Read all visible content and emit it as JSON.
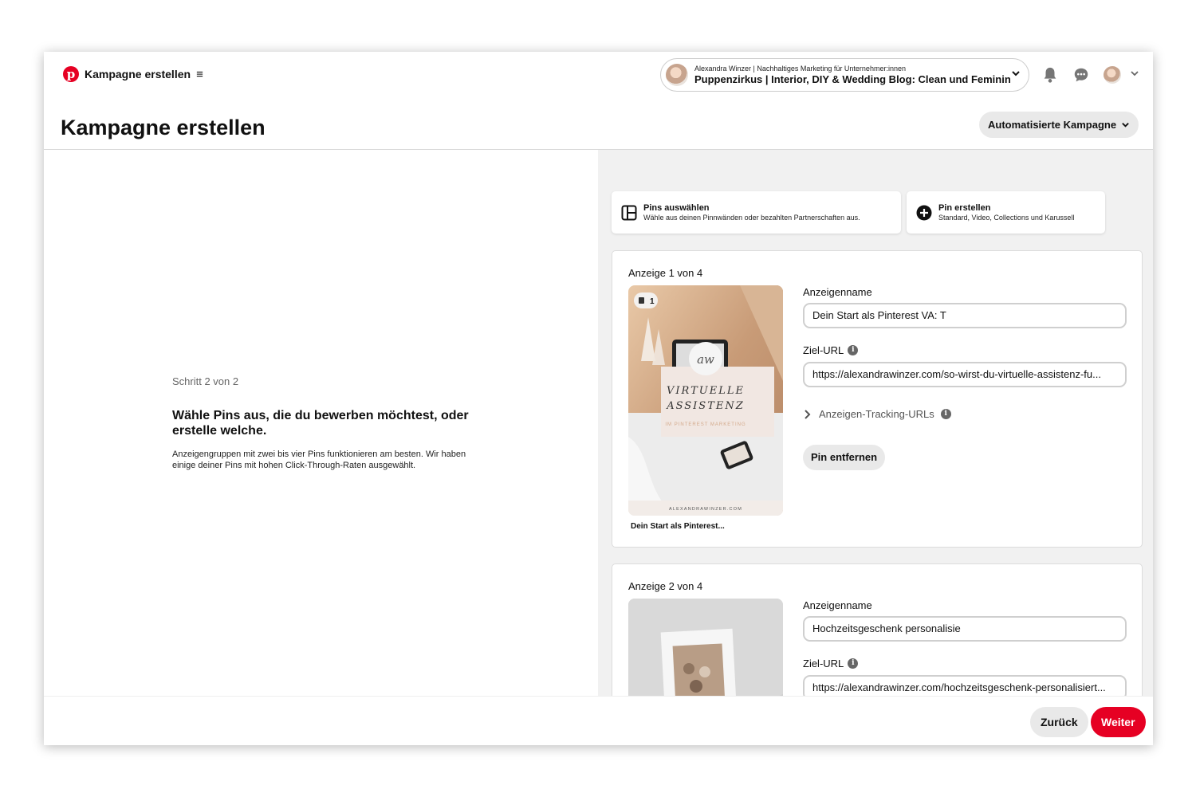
{
  "topbar": {
    "brand_label": "Kampagne erstellen",
    "menu_icon": "hamburger-icon",
    "account": {
      "subtitle": "Alexandra Winzer | Nachhaltiges Marketing für Unternehmer:innen",
      "name": "Puppenzirkus | Interior, DIY & Wedding Blog: Clean und Feminin"
    },
    "icons": [
      "pinterest-logo-icon",
      "bell-icon",
      "chat-icon",
      "chevron-down-icon"
    ]
  },
  "header": {
    "title": "Kampagne erstellen",
    "campaign_type": "Automatisierte Kampagne"
  },
  "left": {
    "step": "Schritt 2 von 2",
    "heading": "Wähle Pins aus, die du bewerben möchtest, oder erstelle welche.",
    "description": "Anzeigengruppen mit zwei bis vier Pins funktionieren am besten. Wir haben einige deiner Pins mit hohen Click-Through-Raten ausgewählt."
  },
  "options": {
    "select": {
      "title": "Pins auswählen",
      "subtitle": "Wähle aus deinen Pinnwänden oder bezahlten Partnerschaften aus."
    },
    "create": {
      "title": "Pin erstellen",
      "subtitle": "Standard, Video, Collections und Karussell"
    }
  },
  "ads": [
    {
      "label": "Anzeige 1 von 4",
      "count_badge": "1",
      "pin_title_line1": "VIRTUELLE",
      "pin_title_line2": "ASSISTENZ",
      "pin_subtitle": "IM PINTEREST MARKETING",
      "pin_monogram": "aw",
      "pin_footer": "ALEXANDRAWINZER.COM",
      "caption": "Dein Start als Pinterest...",
      "name_label": "Anzeigenname",
      "name_value": "Dein Start als Pinterest VA: T",
      "url_label": "Ziel-URL",
      "url_value": "https://alexandrawinzer.com/so-wirst-du-virtuelle-assistenz-fu...",
      "tracking_label": "Anzeigen-Tracking-URLs",
      "remove_label": "Pin entfernen"
    },
    {
      "label": "Anzeige 2 von 4",
      "name_label": "Anzeigenname",
      "name_value": "Hochzeitsgeschenk personalisie",
      "url_label": "Ziel-URL",
      "url_value": "https://alexandrawinzer.com/hochzeitsgeschenk-personalisiert..."
    }
  ],
  "footer": {
    "back": "Zurück",
    "next": "Weiter"
  },
  "colors": {
    "brand_red": "#e60023",
    "pane_bg": "#f1f1f1",
    "button_gray": "#e9e9e9"
  }
}
